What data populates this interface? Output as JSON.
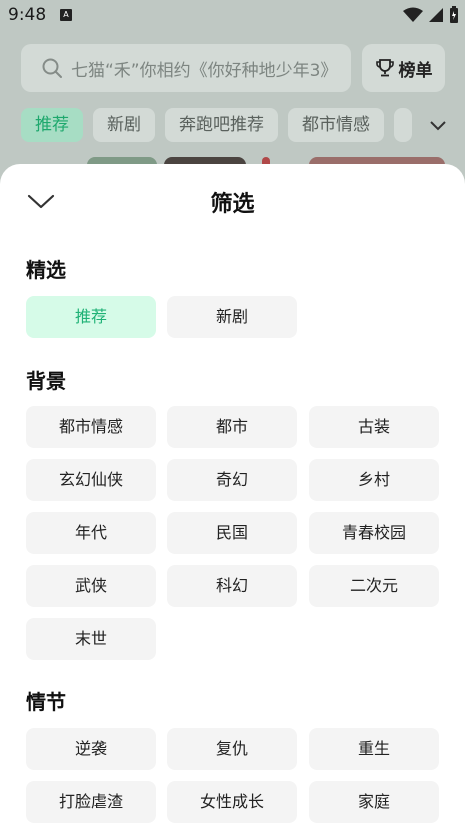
{
  "status": {
    "time": "9:48",
    "notification_icon": "A"
  },
  "search": {
    "placeholder": "七猫“禾”你相约《你好种地少年3》"
  },
  "rank_button": {
    "label": "榜单"
  },
  "tabs": [
    {
      "label": "推荐",
      "active": true
    },
    {
      "label": "新剧"
    },
    {
      "label": "奔跑吧推荐"
    },
    {
      "label": "都市情感"
    }
  ],
  "sheet": {
    "title": "筛选",
    "sections": {
      "selected": {
        "title": "精选",
        "options": [
          "推荐",
          "新剧"
        ],
        "selected": "推荐"
      },
      "background": {
        "title": "背景",
        "options": [
          "都市情感",
          "都市",
          "古装",
          "玄幻仙侠",
          "奇幻",
          "乡村",
          "年代",
          "民国",
          "青春校园",
          "武侠",
          "科幻",
          "二次元",
          "末世"
        ]
      },
      "plot": {
        "title": "情节",
        "options": [
          "逆袭",
          "复仇",
          "重生",
          "打脸虐渣",
          "女性成长",
          "家庭"
        ]
      }
    }
  },
  "colors": {
    "accent": "#1fb276",
    "selected_bg": "#d6fbe8",
    "chip_bg": "#f4f4f4",
    "overlay": "#bfc8c3"
  }
}
